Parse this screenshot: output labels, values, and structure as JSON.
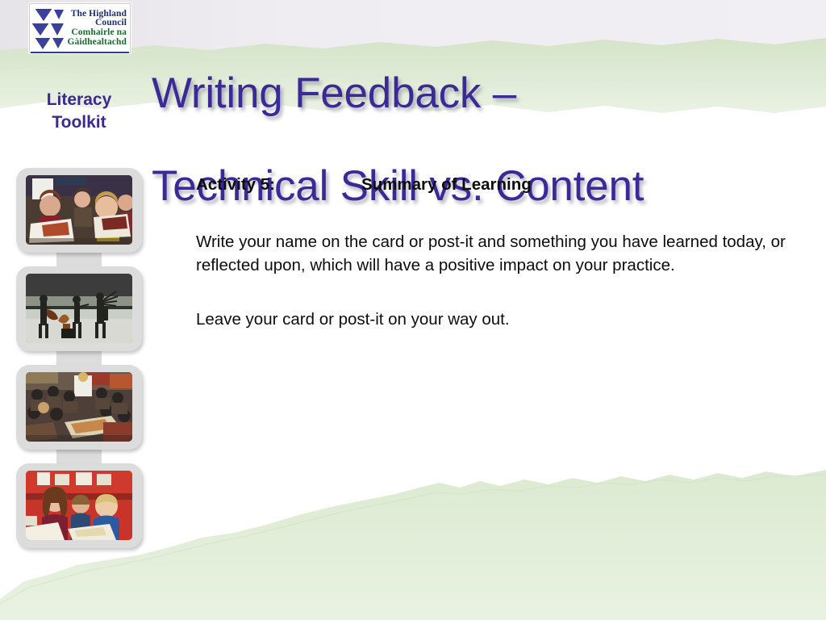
{
  "slide": {
    "title_line_1": "Writing Feedback –",
    "title_line_2": "Technical Skill vs. Content",
    "title_color": "#3b2a96",
    "background_color": "#ffffff",
    "band_green": "#dfead6",
    "band_grey": "#eceaef"
  },
  "logo": {
    "name": "the-highland-council-logo",
    "line_1": "The Highland",
    "line_2": "Council",
    "line_3": "Comhairle na",
    "line_4": "Gàidhealtachd",
    "english_color": "#1f2d7a",
    "gaelic_color": "#1a6b2e",
    "mark_color": "#3b3f9e"
  },
  "brand": {
    "line_1": "Literacy",
    "line_2": "Toolkit",
    "color": "#3b2a8c"
  },
  "filmstrip": {
    "name": "photo-filmstrip",
    "frames": [
      {
        "alt": "children-reading-books-in-classroom"
      },
      {
        "alt": "musicians-silhouetted-on-beach"
      },
      {
        "alt": "busy-classroom-overhead-view"
      },
      {
        "alt": "teacher-helping-pupils-with-writing"
      }
    ]
  },
  "content": {
    "activity_label": "Activity 5:",
    "activity_title": "Summary of Learning",
    "paragraph_1": "Write your name on the card or post-it and something you have learned today, or reflected upon, which will have a positive impact on your practice.",
    "paragraph_2": "Leave your card or post-it on your way out."
  }
}
